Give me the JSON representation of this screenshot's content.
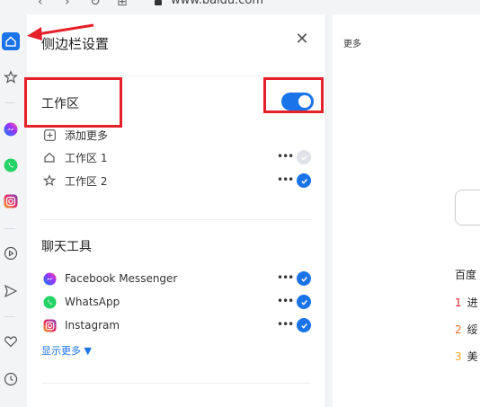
{
  "browser": {
    "url": "www.baidu.com"
  },
  "panel": {
    "title": "侧边栏设置",
    "workspace": {
      "title": "工作区",
      "toggle_on": true,
      "add_more": "添加更多",
      "items": [
        {
          "label": "工作区 1",
          "icon": "home-icon",
          "checked": false
        },
        {
          "label": "工作区 2",
          "icon": "star-icon",
          "checked": true
        }
      ]
    },
    "chat": {
      "title": "聊天工具",
      "items": [
        {
          "label": "Facebook Messenger",
          "icon": "messenger-icon",
          "checked": true
        },
        {
          "label": "WhatsApp",
          "icon": "whatsapp-icon",
          "checked": true
        },
        {
          "label": "Instagram",
          "icon": "instagram-icon",
          "checked": true
        }
      ],
      "show_more": "显示更多 ▼"
    },
    "more_glyph": "•••"
  },
  "page": {
    "more_label": "更多",
    "hot_title": "百度",
    "hot_items": [
      {
        "rank": "1",
        "text": "进",
        "color": "#e5202a"
      },
      {
        "rank": "2",
        "text": "绥",
        "color": "#f26d2b"
      },
      {
        "rank": "3",
        "text": "美",
        "color": "#f5a623"
      }
    ]
  },
  "colors": {
    "accent": "#1a73e8",
    "annotation_red": "#e5202a"
  }
}
